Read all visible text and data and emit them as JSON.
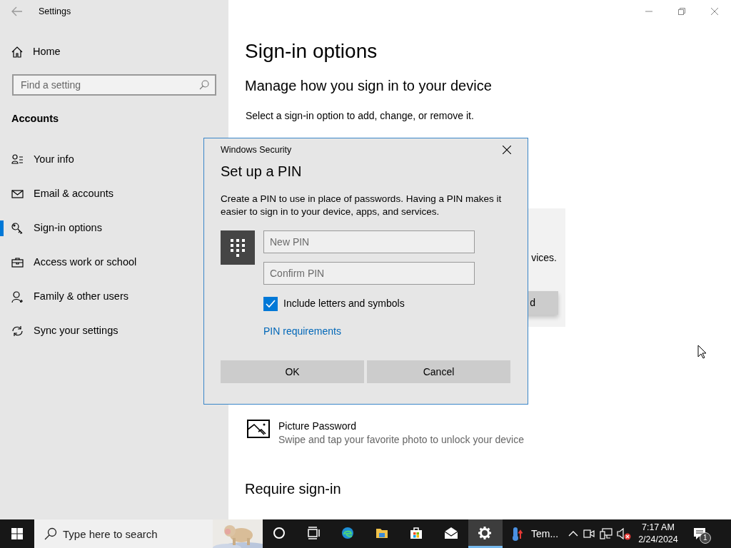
{
  "window": {
    "title": "Settings"
  },
  "sidebar": {
    "home": "Home",
    "search": {
      "placeholder": "Find a setting"
    },
    "section": "Accounts",
    "items": [
      {
        "label": "Your info",
        "kind": "person-list",
        "selected": false
      },
      {
        "label": "Email & accounts",
        "kind": "mail",
        "selected": false
      },
      {
        "label": "Sign-in options",
        "kind": "key",
        "selected": true
      },
      {
        "label": "Access work or school",
        "kind": "briefcase",
        "selected": false
      },
      {
        "label": "Family & other users",
        "kind": "person-add",
        "selected": false
      },
      {
        "label": "Sync your settings",
        "kind": "sync",
        "selected": false
      }
    ]
  },
  "main": {
    "title": "Sign-in options",
    "subtitle": "Manage how you sign in to your device",
    "intro": "Select a sign-in option to add, change, or remove it.",
    "panel": {
      "text_fragment": "vices.",
      "button_fragment": "d"
    },
    "picture_password": {
      "title": "Picture Password",
      "description": "Swipe and tap your favorite photo to unlock your device"
    },
    "require_heading": "Require sign-in"
  },
  "dialog": {
    "caption": "Windows Security",
    "title": "Set up a PIN",
    "description": "Create a PIN to use in place of passwords. Having a PIN makes it easier to sign in to your device, apps, and services.",
    "fields": [
      {
        "placeholder": "New PIN"
      },
      {
        "placeholder": "Confirm PIN"
      }
    ],
    "checkbox": {
      "label": "Include letters and symbols",
      "checked": true
    },
    "link": "PIN requirements",
    "buttons": [
      "OK",
      "Cancel"
    ]
  },
  "taskbar": {
    "search": {
      "placeholder": "Type here to search"
    },
    "apps": [
      {
        "kind": "cortana",
        "selected": false
      },
      {
        "kind": "task-view",
        "selected": false
      },
      {
        "kind": "edge",
        "selected": false
      },
      {
        "kind": "folder",
        "selected": false
      },
      {
        "kind": "store",
        "selected": false
      },
      {
        "kind": "mail",
        "selected": false
      },
      {
        "kind": "settings",
        "selected": true
      },
      {
        "kind": "thermometer",
        "label": "Tem...",
        "selected": false
      }
    ],
    "clock": {
      "time": "7:17 AM",
      "date": "2/24/2024"
    },
    "notifications": {
      "badge": "1"
    }
  }
}
